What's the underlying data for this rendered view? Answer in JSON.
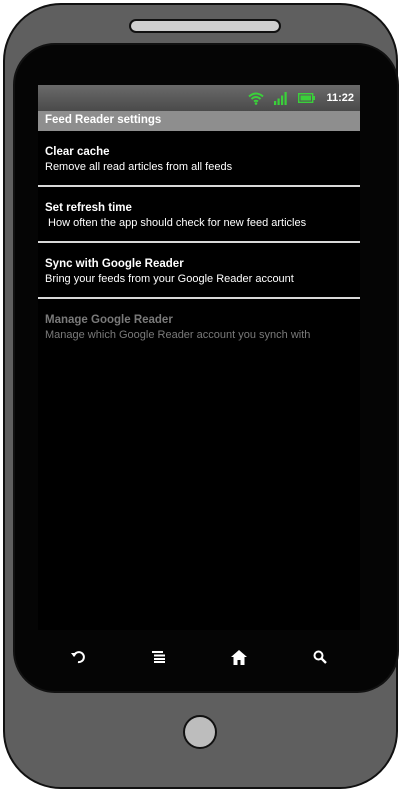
{
  "status_bar": {
    "time": "11:22",
    "icons": [
      "wifi-icon",
      "signal-icon",
      "battery-icon"
    ],
    "accent_color": "#3ad13a"
  },
  "header": {
    "title": "Feed Reader settings"
  },
  "settings": [
    {
      "title": "Clear cache",
      "summary": "Remove all read articles from all feeds",
      "enabled": true
    },
    {
      "title": "Set refresh time",
      "summary": " How often the app should check for new feed articles",
      "enabled": true
    },
    {
      "title": "Sync with Google Reader",
      "summary": "Bring your feeds from your Google Reader account",
      "enabled": true
    },
    {
      "title": "Manage Google Reader",
      "summary": "Manage which Google Reader account you synch with",
      "enabled": false
    }
  ],
  "nav_buttons": [
    "back-icon",
    "menu-icon",
    "home-icon",
    "search-icon"
  ]
}
